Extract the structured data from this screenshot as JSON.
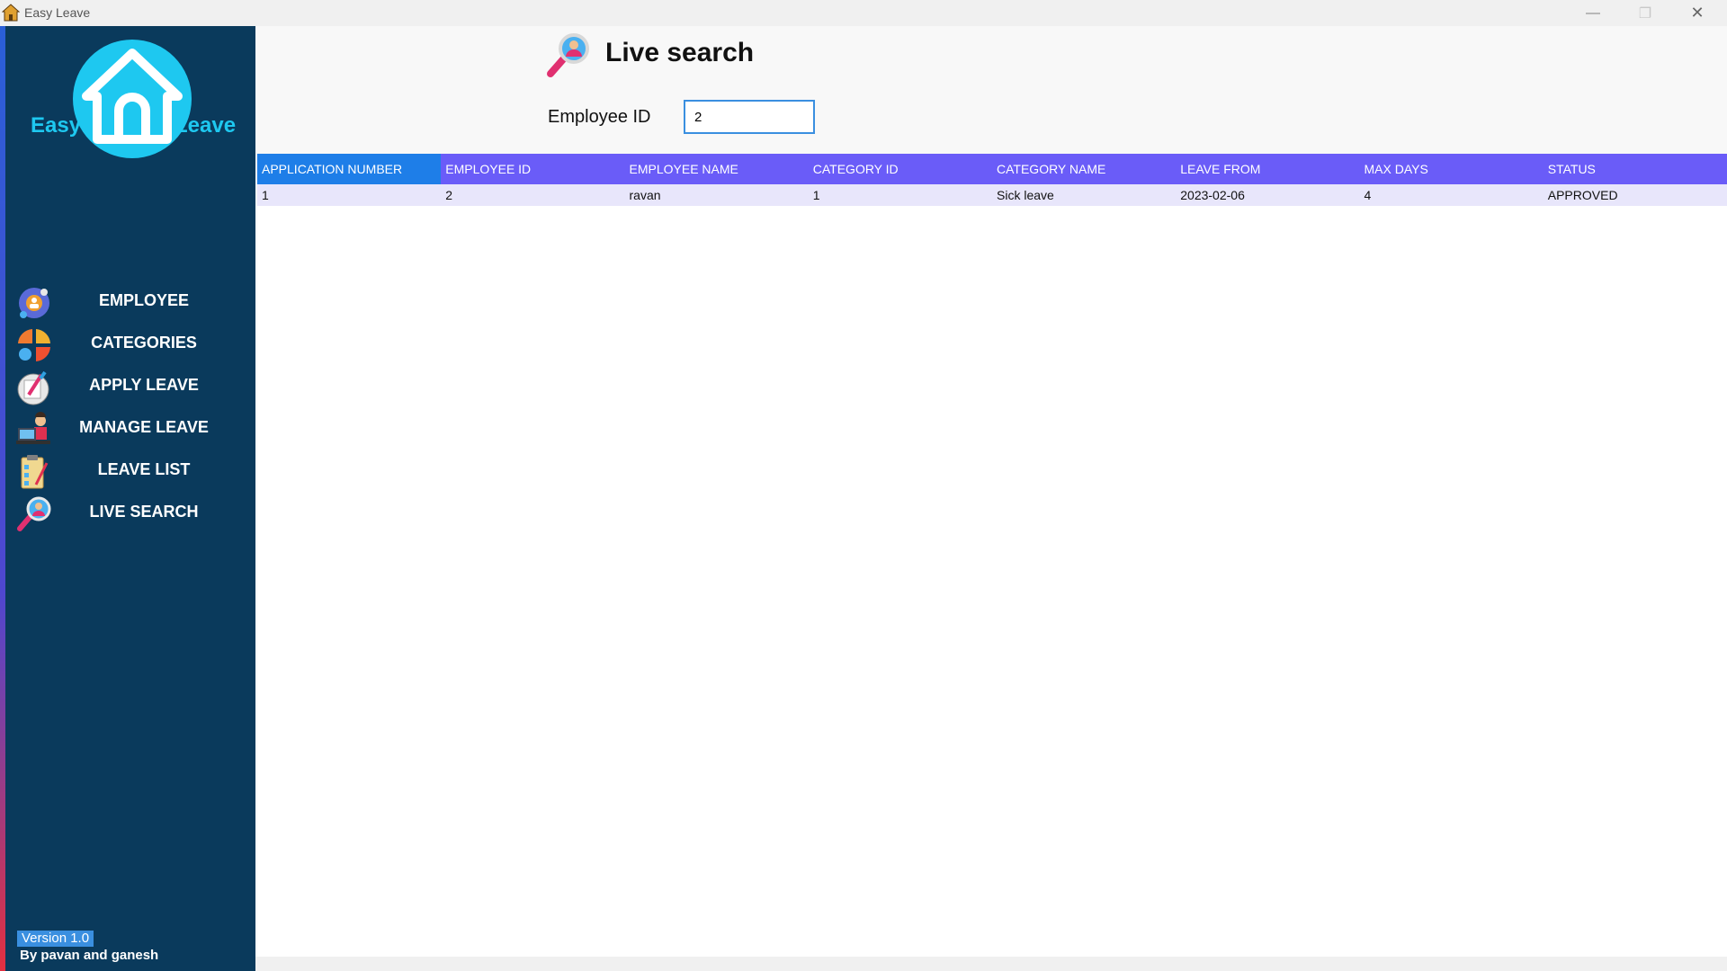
{
  "window": {
    "title": "Easy Leave",
    "minimize_glyph": "—",
    "maximize_glyph": "❐",
    "close_glyph": "✕"
  },
  "sidebar": {
    "logo": {
      "left_word": "Easy",
      "right_word": "Leave"
    },
    "items": [
      {
        "label": "EMPLOYEE",
        "icon": "employee-gear-icon"
      },
      {
        "label": "CATEGORIES",
        "icon": "categories-pie-icon"
      },
      {
        "label": "APPLY LEAVE",
        "icon": "apply-leave-icon"
      },
      {
        "label": "MANAGE LEAVE",
        "icon": "manage-leave-icon"
      },
      {
        "label": "LEAVE LIST",
        "icon": "clipboard-list-icon"
      },
      {
        "label": "LIVE SEARCH",
        "icon": "search-person-icon"
      }
    ],
    "version": "Version 1.0",
    "byline": "By pavan and ganesh"
  },
  "main": {
    "title": "Live search",
    "search": {
      "label": "Employee ID",
      "value": "2"
    },
    "table": {
      "columns": [
        "APPLICATION NUMBER",
        "EMPLOYEE ID",
        "EMPLOYEE NAME",
        "CATEGORY ID",
        "CATEGORY NAME",
        "LEAVE FROM",
        "MAX DAYS",
        "STATUS"
      ],
      "rows": [
        [
          "1",
          "2",
          "ravan",
          "1",
          "Sick leave",
          "2023-02-06",
          "4",
          "APPROVED"
        ]
      ]
    }
  },
  "colors": {
    "sidebar_bg": "#0a3a5c",
    "header_bg": "#6a5cf8",
    "selected_header_bg": "#1e7ee8",
    "row_bg": "#e8e6fb",
    "logo_cyan": "#1ec8f0"
  }
}
